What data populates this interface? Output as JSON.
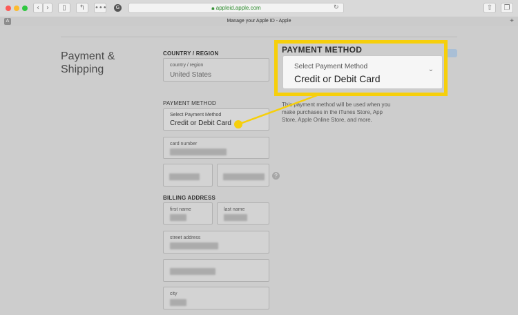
{
  "browser": {
    "url": "appleid.apple.com",
    "tab_title": "Manage your Apple ID - Apple",
    "sidebar_badge": "A",
    "new_tab": "+"
  },
  "page": {
    "section_title": "Payment &\nShipping",
    "country": {
      "label": "COUNTRY / REGION",
      "placeholder": "country / region",
      "value": "United States"
    },
    "payment": {
      "label": "PAYMENT METHOD",
      "placeholder": "Select Payment Method",
      "value": "Credit or Debit Card",
      "card_placeholder": "card number",
      "help": "?"
    },
    "billing": {
      "label": "BILLING ADDRESS",
      "first_name": "first name",
      "last_name": "last name",
      "street": "street address",
      "city": "city"
    },
    "info_text": "This payment method will be used when you make purchases in the iTunes Store, App Store, Apple Online Store, and more."
  },
  "callout": {
    "title": "PAYMENT METHOD",
    "placeholder": "Select Payment Method",
    "value": "Credit or Debit Card"
  },
  "colors": {
    "highlight": "#f6cf0b",
    "url_green": "#2a8a2a"
  },
  "icons": [
    "back-icon",
    "forward-icon",
    "sidebar-icon",
    "share-icon",
    "tabs-icon",
    "reload-icon",
    "chevron-down-icon",
    "help-icon"
  ]
}
